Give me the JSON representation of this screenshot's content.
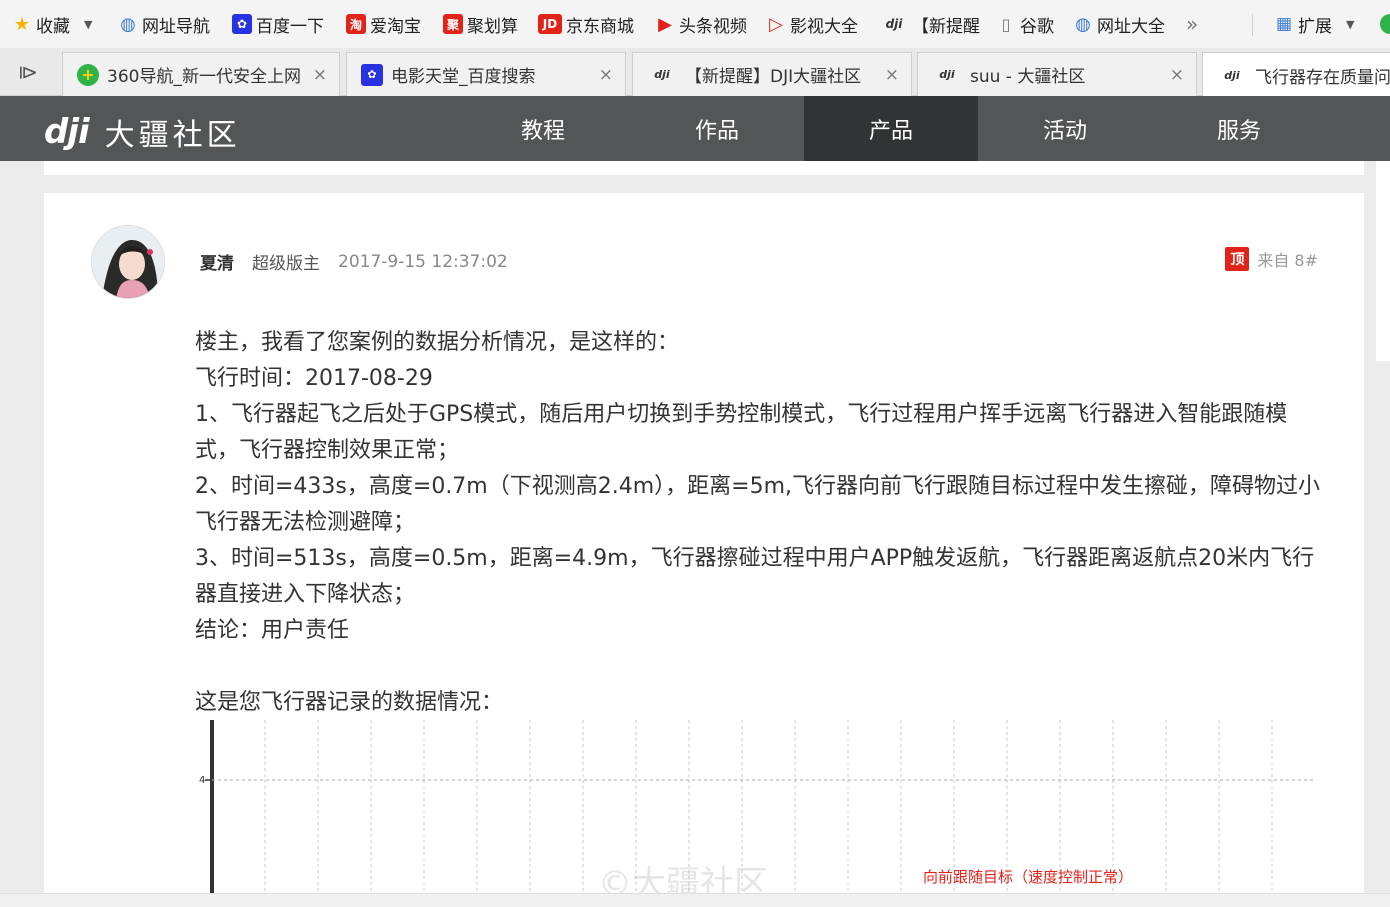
{
  "bookmarks": [
    {
      "label": "收藏",
      "icon": "star-icon",
      "color": "#f5b400"
    },
    {
      "label": "网址导航",
      "icon": "globe-icon",
      "color": "#3a7bd5"
    },
    {
      "label": "百度一下",
      "icon": "paw-icon",
      "color": "#2932e1"
    },
    {
      "label": "爱淘宝",
      "icon": "taobao-icon",
      "color": "#e2231a"
    },
    {
      "label": "聚划算",
      "icon": "juhuasuan-icon",
      "color": "#e2231a"
    },
    {
      "label": "京东商城",
      "icon": "jd-icon",
      "color": "#e2231a"
    },
    {
      "label": "头条视频",
      "icon": "play-icon",
      "color": "#e2231a"
    },
    {
      "label": "影视大全",
      "icon": "play-outline-icon",
      "color": "#e2231a"
    },
    {
      "label": "【新提醒",
      "icon": "dji-icon",
      "color": "#333333"
    },
    {
      "label": "谷歌",
      "icon": "page-icon",
      "color": "#777777"
    },
    {
      "label": "网址大全",
      "icon": "globe-icon",
      "color": "#3a7bd5"
    }
  ],
  "bookmark_more": "»",
  "extensions_label": "扩展",
  "tabs": [
    {
      "title": "360导航_新一代安全上网",
      "icon": "360-icon"
    },
    {
      "title": "电影天堂_百度搜索",
      "icon": "paw-icon"
    },
    {
      "title": "【新提醒】DJI大疆社区",
      "icon": "dji-icon"
    },
    {
      "title": "suu - 大疆社区",
      "icon": "dji-icon"
    },
    {
      "title": "飞行器存在质量问",
      "icon": "dji-icon"
    }
  ],
  "tab_close": "×",
  "site": {
    "logo_mark": "dji",
    "logo_text": "大疆社区",
    "nav": [
      "教程",
      "作品",
      "产品",
      "活动",
      "服务"
    ],
    "active_nav": "产品"
  },
  "post": {
    "author": "夏清",
    "role": "超级版主",
    "time": "2017-9-15 12:37:02",
    "top_badge": "顶",
    "floor": "来自 8#",
    "paragraphs": [
      "楼主，我看了您案例的数据分析情况，是这样的：",
      "飞行时间：2017-08-29",
      "1、飞行器起飞之后处于GPS模式，随后用户切换到手势控制模式，飞行过程用户挥手远离飞行器进入智能跟随模式，飞行器控制效果正常；",
      "2、时间=433s，高度=0.7m（下视测高2.4m），距离=5m,飞行器向前飞行跟随目标过程中发生擦碰，障碍物过小飞行器无法检测避障；",
      "3、时间=513s，高度=0.5m，距离=4.9m，飞行器擦碰过程中用户APP触发返航，飞行器距离返航点20米内飞行器直接进入下降状态；",
      "结论：用户责任",
      "这是您飞行器记录的数据情况："
    ]
  },
  "chart": {
    "y_tick": "4",
    "annotation": "向前跟随目标（速度控制正常）",
    "annotation_color": "#e2231a"
  },
  "watermark": "©大疆社区"
}
